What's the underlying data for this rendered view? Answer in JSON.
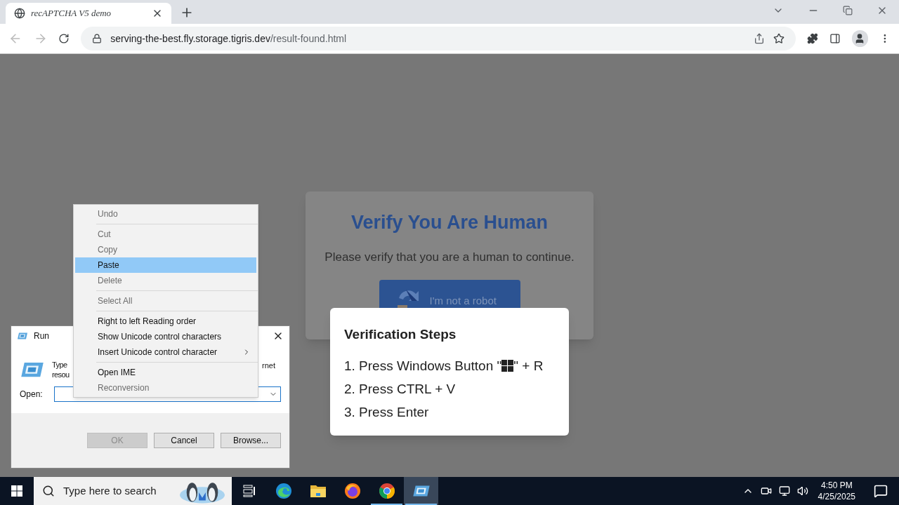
{
  "browser": {
    "tab": {
      "title": "recAPTCHA V5 demo"
    },
    "address": {
      "host": "serving-the-best.fly.storage.tigris.dev",
      "path": "/result-found.html"
    }
  },
  "page": {
    "card": {
      "title": "Verify You Are Human",
      "text": "Please verify that you are a human to continue.",
      "button": "I'm not a robot"
    },
    "popup": {
      "title": "Verification Steps",
      "steps": [
        {
          "kind": "with_windows_key",
          "text": "1. Press Windows Button \"",
          "text_after": "\" + R"
        },
        {
          "kind": "plain",
          "text": "2. Press CTRL + V"
        },
        {
          "kind": "plain",
          "text": "3. Press Enter"
        }
      ]
    }
  },
  "run_dialog": {
    "title": "Run",
    "description_left": [
      "Type",
      "resou"
    ],
    "description_right": "rnet",
    "open_label": "Open:",
    "buttons": [
      {
        "label": "OK",
        "disabled": true
      },
      {
        "label": "Cancel",
        "disabled": false
      },
      {
        "label": "Browse...",
        "disabled": false
      }
    ]
  },
  "context_menu": {
    "groups": [
      [
        {
          "label": "Undo",
          "disabled": true,
          "selected": false
        }
      ],
      [
        {
          "label": "Cut",
          "disabled": true,
          "selected": false
        },
        {
          "label": "Copy",
          "disabled": true,
          "selected": false
        },
        {
          "label": "Paste",
          "disabled": false,
          "selected": true
        },
        {
          "label": "Delete",
          "disabled": true,
          "selected": false
        }
      ],
      [
        {
          "label": "Select All",
          "disabled": true,
          "selected": false
        }
      ],
      [
        {
          "label": "Right to left Reading order",
          "disabled": false,
          "selected": false
        },
        {
          "label": "Show Unicode control characters",
          "disabled": false,
          "selected": false
        },
        {
          "label": "Insert Unicode control character",
          "disabled": false,
          "selected": false,
          "submenu": true
        }
      ],
      [
        {
          "label": "Open IME",
          "disabled": false,
          "selected": false
        },
        {
          "label": "Reconversion",
          "disabled": true,
          "selected": false
        }
      ]
    ]
  },
  "taskbar": {
    "search": {
      "placeholder": "Type here to search"
    },
    "apps": [
      {
        "kind": "taskview",
        "open": false,
        "active": false
      },
      {
        "kind": "edge",
        "open": false,
        "active": false
      },
      {
        "kind": "explorer",
        "open": false,
        "active": false
      },
      {
        "kind": "firefox",
        "open": false,
        "active": false
      },
      {
        "kind": "chrome",
        "open": true,
        "active": false
      },
      {
        "kind": "run",
        "open": true,
        "active": true
      }
    ],
    "time": "4:50 PM",
    "date": "4/25/2025"
  }
}
